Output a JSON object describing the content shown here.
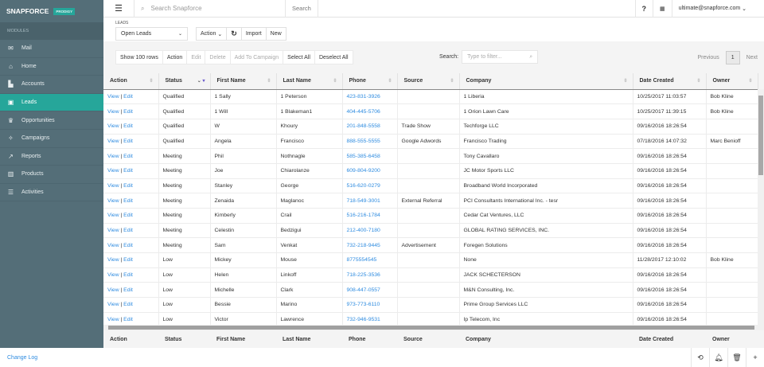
{
  "app": {
    "logo": "SNAPFORCE",
    "edition": "PRODIGY",
    "colors": {
      "sidebar": "#546e78",
      "accent": "#26a69a",
      "link": "#2f8ce0"
    }
  },
  "sidebar": {
    "section": "MODULES",
    "items": [
      {
        "label": "Mail",
        "icon": "mail-icon",
        "glyph": "✉"
      },
      {
        "label": "Home",
        "icon": "home-icon",
        "glyph": "⌂"
      },
      {
        "label": "Accounts",
        "icon": "building-icon",
        "glyph": "▙"
      },
      {
        "label": "Leads",
        "icon": "lead-icon",
        "glyph": "▣",
        "active": true
      },
      {
        "label": "Opportunities",
        "icon": "crown-icon",
        "glyph": "♛"
      },
      {
        "label": "Campaigns",
        "icon": "satellite-icon",
        "glyph": "✧"
      },
      {
        "label": "Reports",
        "icon": "chart-icon",
        "glyph": "↗"
      },
      {
        "label": "Products",
        "icon": "barcode-icon",
        "glyph": "▥"
      },
      {
        "label": "Activities",
        "icon": "list-icon",
        "glyph": "☰"
      }
    ]
  },
  "topbar": {
    "search_placeholder": "Search Snapforce",
    "search_button": "Search",
    "help": "?",
    "user": "ultimate@snapforce.com"
  },
  "header": {
    "module_label": "LEADS",
    "view": "Open Leads",
    "action": "Action",
    "import": "Import",
    "new": "New"
  },
  "toolbar": {
    "show_rows": "Show 100 rows",
    "action": "Action",
    "edit": "Edit",
    "delete": "Delete",
    "add_campaign": "Add To Campaign",
    "select_all": "Select All",
    "deselect_all": "Deselect All",
    "search_label": "Search:",
    "filter_placeholder": "Type to filter...",
    "previous": "Previous",
    "page": "1",
    "next": "Next"
  },
  "table": {
    "columns": [
      "Action",
      "Status",
      "First Name",
      "Last Name",
      "Phone",
      "Source",
      "Company",
      "Date Created",
      "Owner"
    ],
    "view": "View",
    "edit": "Edit",
    "rows": [
      [
        "Qualified",
        "1 Sally",
        "1 Peterson",
        "423-831-3926",
        "",
        "1 Liberia",
        "10/25/2017 11:03:57",
        "Bob Kline"
      ],
      [
        "Qualified",
        "1 Will",
        "1 Blakeman1",
        "404-445-5706",
        "",
        "1 Orion Lawn Care",
        "10/25/2017 11:39:15",
        "Bob Kline"
      ],
      [
        "Qualified",
        "W",
        "Khoury",
        "201-848-5558",
        "Trade Show",
        "Techforge LLC",
        "09/16/2016 18:26:54",
        ""
      ],
      [
        "Qualified",
        "Angela",
        "Francisco",
        "888-555-5555",
        "Google Adwords",
        "Francisco Trading",
        "07/18/2016 14:07:32",
        "Marc Benioff"
      ],
      [
        "Meeting",
        "Phil",
        "Nothnagle",
        "585-385-6458",
        "",
        "Tony Cavallaro",
        "09/16/2016 18:26:54",
        ""
      ],
      [
        "Meeting",
        "Joe",
        "Chiarolanze",
        "609-804-9200",
        "",
        "JC Motor Sports LLC",
        "09/16/2016 18:26:54",
        ""
      ],
      [
        "Meeting",
        "Stanley",
        "George",
        "516-620-0279",
        "",
        "Broadband World Incorporated",
        "09/16/2016 18:26:54",
        ""
      ],
      [
        "Meeting",
        "Zenaida",
        "Maglanoc",
        "718-549-3001",
        "External Referral",
        "PCI Consultants International Inc. - tesr",
        "09/16/2016 18:26:54",
        ""
      ],
      [
        "Meeting",
        "Kimberly",
        "Crail",
        "516-216-1784",
        "",
        "Cedar Cat Ventures, LLC",
        "09/16/2016 18:26:54",
        ""
      ],
      [
        "Meeting",
        "Celestin",
        "Bedzigui",
        "212-400-7180",
        "",
        "GLOBAL RATING SERVICES, INC.",
        "09/16/2016 18:26:54",
        ""
      ],
      [
        "Meeting",
        "Sam",
        "Venkat",
        "732-218-9445",
        "Advertisement",
        "Foregen Solutions",
        "09/16/2016 18:26:54",
        ""
      ],
      [
        "Low",
        "Mickey",
        "Mouse",
        "8775554545",
        "",
        "None",
        "11/28/2017 12:10:02",
        "Bob Kline"
      ],
      [
        "Low",
        "Helen",
        "Linkoff",
        "718-225-3536",
        "",
        "JACK SCHECTERSON",
        "09/16/2016 18:26:54",
        ""
      ],
      [
        "Low",
        "Michelle",
        "Clark",
        "908-447-0557",
        "",
        "M&N Consulting, Inc.",
        "09/16/2016 18:26:54",
        ""
      ],
      [
        "Low",
        "Bessie",
        "Marino",
        "973-773-6110",
        "",
        "Prime Group Services LLC",
        "09/16/2016 18:26:54",
        ""
      ],
      [
        "Low",
        "Victor",
        "Lawrence",
        "732-946-9531",
        "",
        "Ip Telecom, Inc",
        "09/16/2016 18:26:54",
        ""
      ]
    ]
  },
  "footer": {
    "change_log": "Change Log",
    "icons": [
      "history-icon",
      "bell-icon",
      "trash-icon",
      "plus-icon"
    ]
  }
}
